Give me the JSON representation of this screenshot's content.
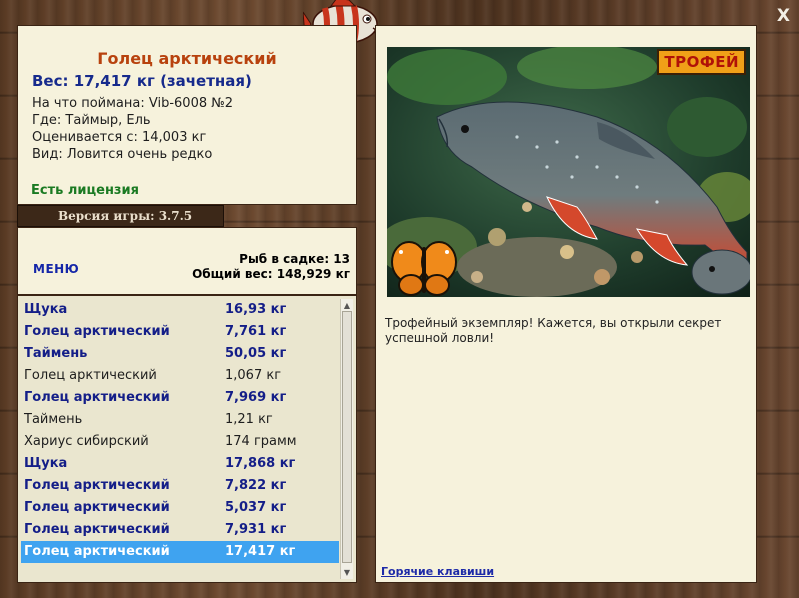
{
  "fish_card": {
    "title": "Голец арктический",
    "weight_line": "Вес: 17,417 кг (зачетная)",
    "caught_on": "На что поймана: Vib-6008 №2",
    "location": "Где: Таймыр, Ель",
    "price": "Оценивается с: 14,003 кг",
    "rarity": "Вид: Ловится очень редко",
    "license": "Есть лицензия"
  },
  "version_label": "Версия игры: 3.7.5",
  "menu": {
    "menu_label": "МЕНЮ",
    "keepnet_count": "Рыб в садке: 13",
    "total_weight": "Общий вес: 148,929 кг"
  },
  "catch_list": [
    {
      "name": "Щука",
      "weight": "16,93 кг",
      "highlight": true
    },
    {
      "name": "Голец арктический",
      "weight": "7,761 кг",
      "highlight": true
    },
    {
      "name": "Таймень",
      "weight": "50,05 кг",
      "highlight": true
    },
    {
      "name": "Голец арктический",
      "weight": "1,067 кг",
      "highlight": false
    },
    {
      "name": "Голец арктический",
      "weight": "7,969 кг",
      "highlight": true
    },
    {
      "name": "Таймень",
      "weight": "1,21 кг",
      "highlight": false
    },
    {
      "name": "Хариус сибирский",
      "weight": "174 грамм",
      "highlight": false
    },
    {
      "name": "Щука",
      "weight": "17,868 кг",
      "highlight": true
    },
    {
      "name": "Голец арктический",
      "weight": "7,822 кг",
      "highlight": true
    },
    {
      "name": "Голец арктический",
      "weight": "5,037 кг",
      "highlight": true
    },
    {
      "name": "Голец арктический",
      "weight": "7,931 кг",
      "highlight": true
    },
    {
      "name": "Голец арктический",
      "weight": "17,417 кг",
      "highlight": true,
      "selected": true
    }
  ],
  "trophy_badge": "ТРОФЕЙ",
  "message": "Трофейный экземпляр! Кажется, вы открыли секрет успешной ловли!",
  "hotkeys_link": "Горячие клавиши",
  "close_symbol": "X",
  "icons": {
    "close": "close-icon",
    "logo": "fish-logo-icon",
    "butterfly": "butterfly-icon",
    "scroll_up": "scroll-up-arrow-icon",
    "scroll_down": "scroll-down-arrow-icon"
  },
  "colors": {
    "title": "#b8420e",
    "weight": "#162a8c",
    "license": "#1a7a22",
    "selection": "#3fa3f0",
    "panel": "#f6f2dc"
  }
}
